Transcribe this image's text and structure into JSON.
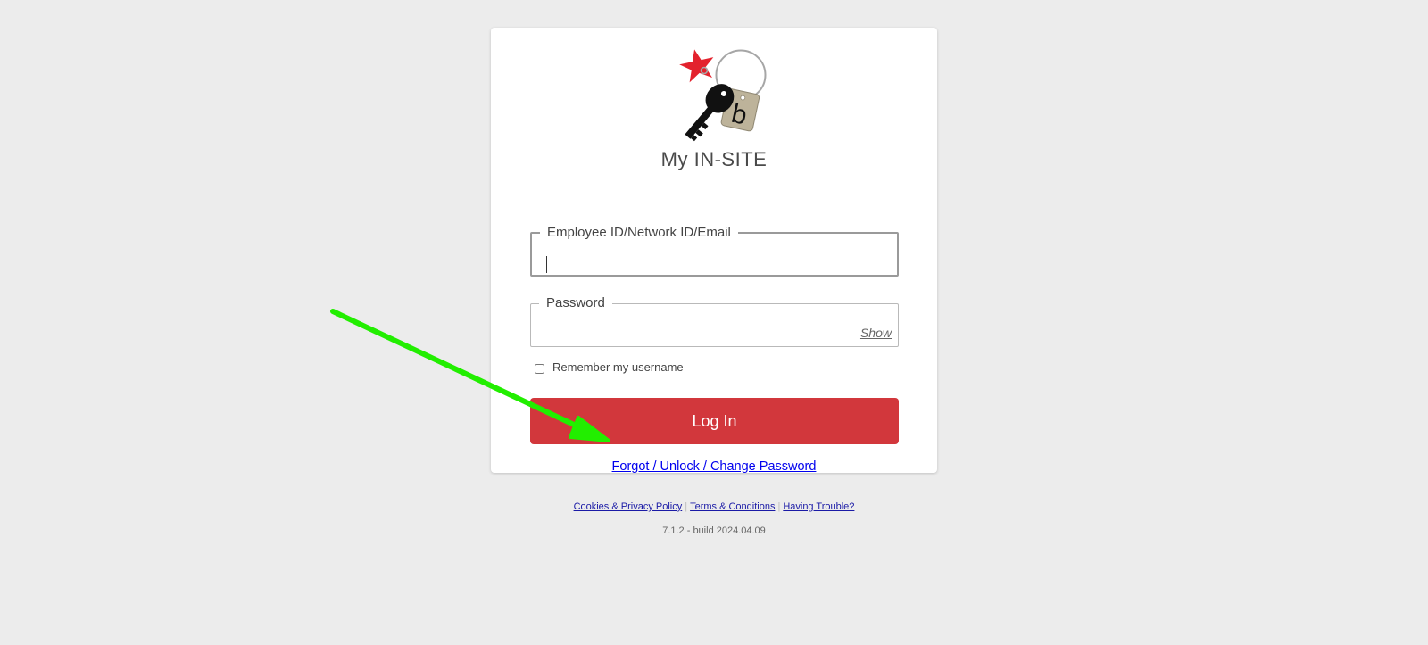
{
  "app": {
    "title": "My IN-SITE",
    "logo_icon": "keychain-logo-icon",
    "logo_letter": "b"
  },
  "form": {
    "username_label": "Employee ID/Network ID/Email",
    "username_value": "",
    "password_label": "Password",
    "password_value": "",
    "show_label": "Show",
    "remember_label": "Remember my username",
    "remember_checked": false,
    "login_label": "Log In",
    "forgot_label": "Forgot / Unlock / Change Password"
  },
  "footer": {
    "links": [
      "Cookies & Privacy Policy",
      "Terms & Conditions",
      "Having Trouble?"
    ],
    "version": "7.1.2 - build 2024.04.09"
  },
  "annotation": {
    "arrow_icon": "green-arrow-icon",
    "arrow_color": "#22ee00"
  },
  "colors": {
    "background": "#ececec",
    "card": "#ffffff",
    "accent": "#d2373c",
    "star": "#e3222d",
    "link": "#0000ee"
  }
}
